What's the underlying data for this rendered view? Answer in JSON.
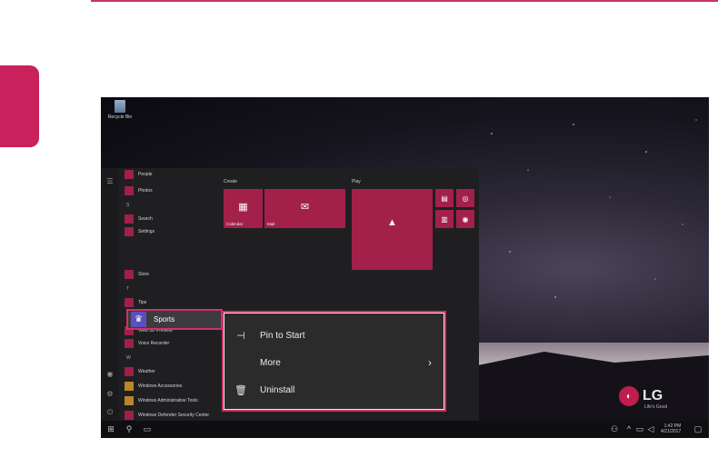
{
  "desktop": {
    "recycle_bin_label": "Recycle Bin"
  },
  "start_menu": {
    "groups": {
      "create": "Create",
      "play": "Play"
    },
    "apps": {
      "people": "People",
      "photos": "Photos",
      "letter_s": "S",
      "search": "Search",
      "settings": "Settings",
      "store": "Store",
      "letter_t": "T",
      "tips": "Tips",
      "letter_v": "V",
      "view_3d": "View 3D Preview",
      "voice_recorder": "Voice Recorder",
      "letter_w": "W",
      "weather": "Weather",
      "win_accessories": "Windows Accessories",
      "win_admin_tools": "Windows Administrative Tools",
      "win_defender": "Windows Defender Security Center"
    },
    "tiles": {
      "calendar": "Calendar",
      "mail": "Mail",
      "weather": "Weather"
    },
    "selected_app": "Sports"
  },
  "context_menu": {
    "items": [
      {
        "label": "Pin to Start",
        "icon": "pin-icon"
      },
      {
        "label": "More",
        "icon": "chevron-right-icon"
      },
      {
        "label": "Uninstall",
        "icon": "trash-icon"
      }
    ]
  },
  "branding": {
    "logo_text": "LG",
    "tagline": "Life's Good"
  },
  "taskbar": {
    "time": "1:42 PM",
    "date": "4/21/2017"
  },
  "colors": {
    "accent": "#c9215b",
    "highlight_border": "#d03165",
    "tile": "#a3204b"
  }
}
